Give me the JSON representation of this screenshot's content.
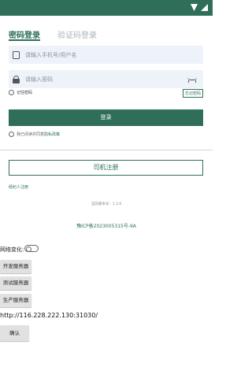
{
  "tabs": {
    "password_login": "密码登录",
    "code_login": "验证码登录"
  },
  "form": {
    "phone_placeholder": "请输入手机号/用户名",
    "password_placeholder": "请输入密码",
    "remember_label": "记住密码",
    "forgot_label": "忘记密码",
    "login_button": "登录",
    "agreement_text": "我已阅读并同意",
    "privacy_link": "隐私政策"
  },
  "driver_register_button": "司机注册",
  "broker_register_link": "经纪人注册",
  "version_text": "当前版本号：1.3.6",
  "icp_text": "豫ICP备2023005315号-9A",
  "env": {
    "label": "网络变化:",
    "dev_server": "开发服务器",
    "test_server": "测试服务器",
    "prod_server": "生产服务器",
    "url": "http://116.228.222.130:31030/",
    "confirm": "确认"
  },
  "colors": {
    "accent": "#2f6f5a",
    "input_bg": "#eef2f9"
  }
}
